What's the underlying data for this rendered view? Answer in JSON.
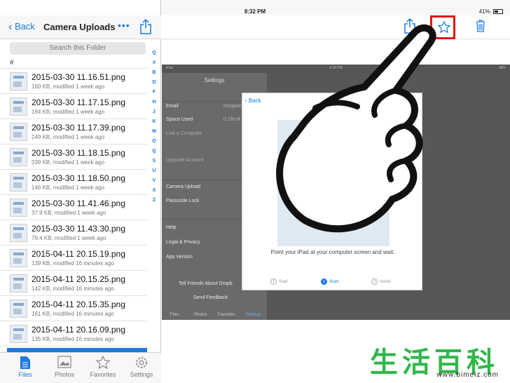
{
  "status": {
    "device": "iPad",
    "time": "8:32 PM",
    "battery": "41%"
  },
  "nav": {
    "back_label": "Back",
    "title": "Camera Uploads"
  },
  "search": {
    "placeholder": "Search this Folder"
  },
  "section_header": "#",
  "files": [
    {
      "name": "2015-03-30 11.16.51.png",
      "meta": "160 KB, modified 1 week ago"
    },
    {
      "name": "2015-03-30 11.17.15.png",
      "meta": "194 KB, modified 1 week ago"
    },
    {
      "name": "2015-03-30 11.17.39.png",
      "meta": "249 KB, modified 1 week ago"
    },
    {
      "name": "2015-03-30 11.18.15.png",
      "meta": "339 KB, modified 1 week ago"
    },
    {
      "name": "2015-03-30 11.18.50.png",
      "meta": "146 KB, modified 1 week ago"
    },
    {
      "name": "2015-03-30 11.41.46.png",
      "meta": "37.9 KB, modified 1 week ago"
    },
    {
      "name": "2015-03-30 11.43.30.png",
      "meta": "79.4 KB, modified 1 week ago"
    },
    {
      "name": "2015-04-11 20.15.19.png",
      "meta": "139 KB, modified 16 minutes ago"
    },
    {
      "name": "2015-04-11 20.15.25.png",
      "meta": "142 KB, modified 16 minutes ago"
    },
    {
      "name": "2015-04-11 20.15.35.png",
      "meta": "161 KB, modified 16 minutes ago"
    },
    {
      "name": "2015-04-11 20.16.09.png",
      "meta": "135 KB, modified 16 minutes ago"
    }
  ],
  "index_letters": [
    "Q",
    "#",
    "B",
    "D",
    "F",
    "H",
    "J",
    "K",
    "M",
    "O",
    "Q",
    "S",
    "U",
    "V",
    "X",
    "Z"
  ],
  "tabs": [
    {
      "label": "Files"
    },
    {
      "label": "Photos"
    },
    {
      "label": "Favorites"
    },
    {
      "label": "Settings"
    }
  ],
  "preview": {
    "status_left": "iPad",
    "status_time": "8:18 PM",
    "status_right": "48%",
    "settings_title": "Settings",
    "email_label": "Email",
    "email_value": "mrsjanesmith@dropbo",
    "space_label": "Space Used",
    "space_value": "0.1% of",
    "link_label": "Link a Computer",
    "upgrade_label": "Upgrade Account",
    "camera_upload": "Camera Upload",
    "passcode_lock": "Passcode Lock",
    "help": "Help",
    "legal": "Legal & Privacy",
    "app_version": "App Version",
    "tell_friends": "Tell Friends About Dropb",
    "send_feedback": "Send Feedback",
    "tabs": [
      "Files",
      "Photos",
      "Favorites",
      "Settings"
    ],
    "modal_back": "Back",
    "modal_text": "Point your iPad at your computer screen and wait.",
    "steps": [
      "Start",
      "Scan",
      "Install"
    ]
  },
  "watermark": {
    "text": "生活百科",
    "url": "www.bimeiz.com"
  },
  "colors": {
    "accent": "#1a7ae0",
    "highlight": "#e01515",
    "watermark": "#2fb84a"
  }
}
